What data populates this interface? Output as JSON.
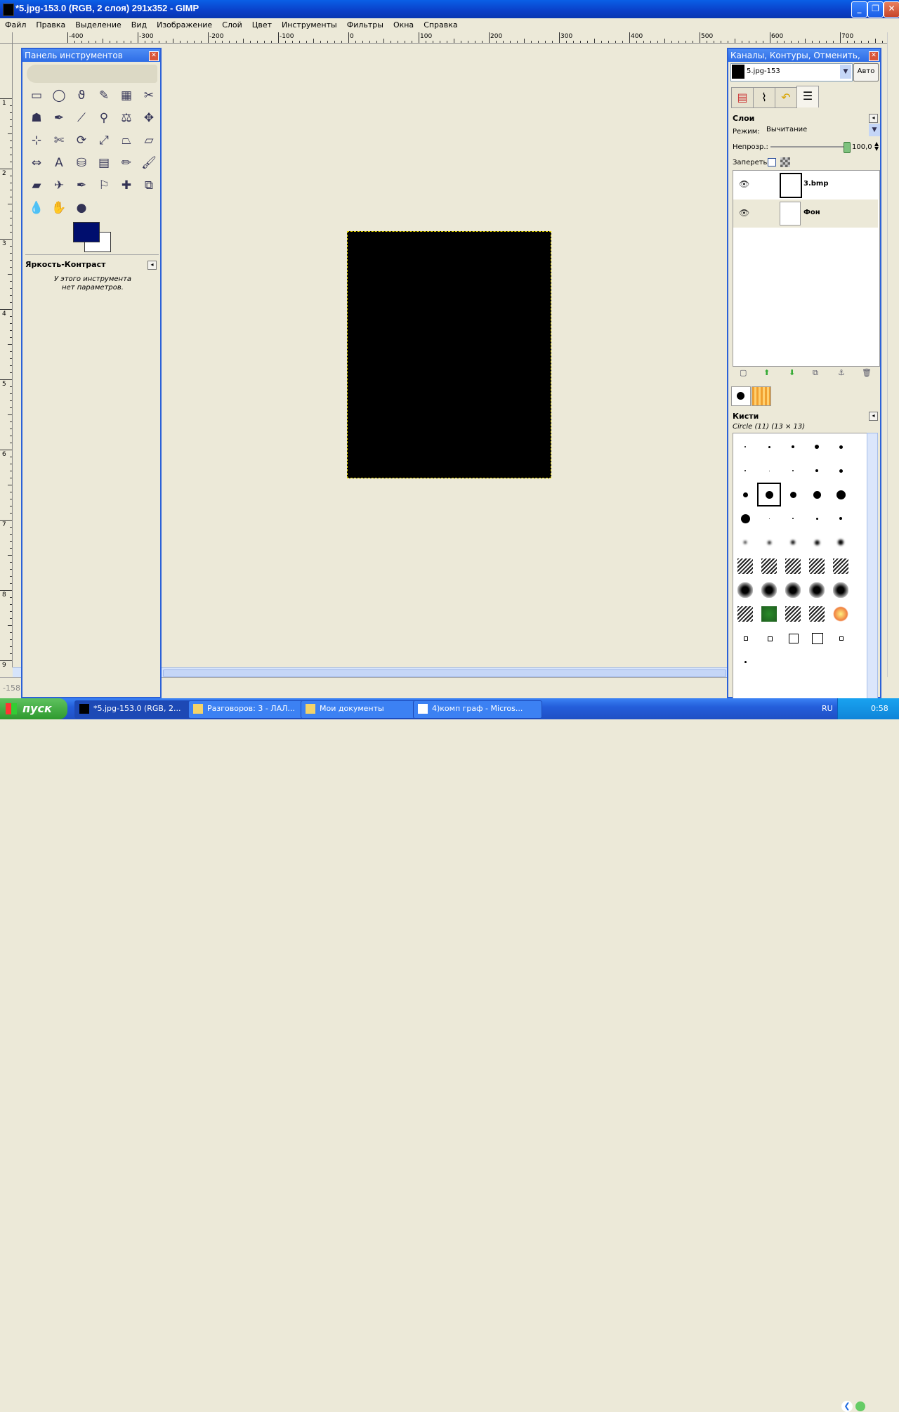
{
  "window": {
    "title": "*5.jpg-153.0 (RGB, 2 слоя) 291x352 - GIMP",
    "min_label": "_",
    "max_label": "❐",
    "close_label": "✕"
  },
  "menu": [
    "Файл",
    "Правка",
    "Выделение",
    "Вид",
    "Изображение",
    "Слой",
    "Цвет",
    "Инструменты",
    "Фильтры",
    "Окна",
    "Справка"
  ],
  "ruler": {
    "h_labels": [
      "-400",
      "-300",
      "-200",
      "-100",
      "0",
      "100",
      "200",
      "300",
      "400",
      "500",
      "600",
      "700"
    ],
    "v_labels": [
      "1",
      "2",
      "3",
      "4",
      "5",
      "6",
      "7",
      "8",
      "9"
    ]
  },
  "status": {
    "coord": "-158"
  },
  "toolbox": {
    "title": "Панель инструментов",
    "close": "✕",
    "tools": [
      "rect-select",
      "ellipse-select",
      "free-select",
      "fuzzy-select",
      "color-select",
      "scissors-select",
      "foreground-select",
      "paths",
      "color-picker",
      "zoom",
      "measure",
      "move",
      "align",
      "crop",
      "rotate",
      "scale",
      "shear",
      "perspective",
      "flip",
      "text",
      "bucket-fill",
      "blend",
      "pencil",
      "paintbrush",
      "eraser",
      "airbrush",
      "ink",
      "clone",
      "heal",
      "perspective-clone",
      "blur",
      "smudge",
      "dodge-burn"
    ],
    "tool_glyphs": [
      "▭",
      "◯",
      "ϑ",
      "✎",
      "▦",
      "✂",
      "☗",
      "✒",
      "⟋",
      "⚲",
      "⚖",
      "✥",
      "⊹",
      "✄",
      "⟳",
      "⤢",
      "⏢",
      "⏥",
      "⇔",
      "A",
      "⛁",
      "▤",
      "✏",
      "🖌",
      "▰",
      "✈",
      "✒",
      "⚐",
      "✚",
      "⧉",
      "💧",
      "✋",
      "●"
    ],
    "fg_color": "#000e6e",
    "bg_color": "#ffffff",
    "options_title": "Яркость-Контраст",
    "options_msg1": "У этого инструмента",
    "options_msg2": "нет параметров."
  },
  "dock": {
    "title": "Каналы, Контуры, Отменить, Сло...",
    "close": "✕",
    "image_name": "5.jpg-153",
    "auto_button": "Авто",
    "layers_title": "Слои",
    "mode_label": "Режим:",
    "mode_value": "Вычитание",
    "opacity_label": "Непрозр.:",
    "opacity_value": "100,0",
    "lock_label": "Запереть:",
    "layers": [
      {
        "name": "3.bmp"
      },
      {
        "name": "Фон"
      }
    ],
    "brushes_title": "Кисти",
    "brush_name": "Circle (11) (13 × 13)"
  },
  "taskbar": {
    "start": "пуск",
    "tasks": [
      "*5.jpg-153.0 (RGB, 2...",
      "Разговоров: 3 - ЛАЛ...",
      "Мои документы",
      "4)комп граф - Micros..."
    ],
    "lang": "RU",
    "clock": "0:58"
  }
}
